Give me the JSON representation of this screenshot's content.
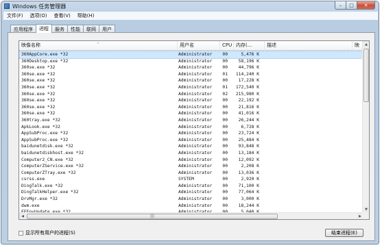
{
  "window": {
    "title": "Windows 任务管理器"
  },
  "caption_buttons": {
    "minimize": "–",
    "maximize": "□",
    "close": "✕"
  },
  "menu": [
    {
      "label": "文件(F)"
    },
    {
      "label": "选项(O)"
    },
    {
      "label": "查看(V)"
    },
    {
      "label": "帮助(H)"
    }
  ],
  "tabs": [
    {
      "label": "应用程序",
      "active": false
    },
    {
      "label": "进程",
      "active": true
    },
    {
      "label": "服务",
      "active": false
    },
    {
      "label": "性能",
      "active": false
    },
    {
      "label": "联网",
      "active": false
    },
    {
      "label": "用户",
      "active": false
    }
  ],
  "columns": {
    "name": "映像名称",
    "user": "用户名",
    "cpu": "CPU",
    "mem": "内存(...",
    "desc": "描述",
    "extra": "映"
  },
  "sort_indicator": "^",
  "processes": [
    {
      "name": "360AppCore.exe *32",
      "user": "Administrator",
      "cpu": "00",
      "mem": "5,476 K",
      "selected": true
    },
    {
      "name": "360Desktop.exe *32",
      "user": "Administrator",
      "cpu": "00",
      "mem": "58,196 K"
    },
    {
      "name": "360se.exe *32",
      "user": "Administrator",
      "cpu": "00",
      "mem": "44,796 K"
    },
    {
      "name": "360se.exe *32",
      "user": "Administrator",
      "cpu": "01",
      "mem": "114,240 K"
    },
    {
      "name": "360se.exe *32",
      "user": "Administrator",
      "cpu": "00",
      "mem": "17,228 K"
    },
    {
      "name": "360se.exe *32",
      "user": "Administrator",
      "cpu": "01",
      "mem": "172,540 K"
    },
    {
      "name": "360se.exe *32",
      "user": "Administrator",
      "cpu": "02",
      "mem": "215,980 K"
    },
    {
      "name": "360se.exe *32",
      "user": "Administrator",
      "cpu": "00",
      "mem": "22,192 K"
    },
    {
      "name": "360se.exe *32",
      "user": "Administrator",
      "cpu": "00",
      "mem": "21,816 K"
    },
    {
      "name": "360se.exe *32",
      "user": "Administrator",
      "cpu": "00",
      "mem": "41,016 K"
    },
    {
      "name": "360tray.exe *32",
      "user": "Administrator",
      "cpu": "00",
      "mem": "26,244 K"
    },
    {
      "name": "ApkLook.exe *32",
      "user": "Administrator",
      "cpu": "00",
      "mem": "6,728 K"
    },
    {
      "name": "AppSubProc.exe *32",
      "user": "Administrator",
      "cpu": "00",
      "mem": "23,724 K"
    },
    {
      "name": "AppSubProc.exe *32",
      "user": "Administrator",
      "cpu": "00",
      "mem": "25,484 K"
    },
    {
      "name": "baidunetdisk.exe *32",
      "user": "Administrator",
      "cpu": "00",
      "mem": "93,848 K"
    },
    {
      "name": "baidunetdiskhost.exe *32",
      "user": "Administrator",
      "cpu": "00",
      "mem": "13,184 K"
    },
    {
      "name": "Computer2_CN.exe *32",
      "user": "Administrator",
      "cpu": "00",
      "mem": "12,092 K"
    },
    {
      "name": "ComputerZService.exe *32",
      "user": "Administrator",
      "cpu": "00",
      "mem": "2,208 K"
    },
    {
      "name": "ComputerZTray.exe *32",
      "user": "Administrator",
      "cpu": "00",
      "mem": "13,036 K"
    },
    {
      "name": "csrss.exe",
      "user": "SYSTEM",
      "cpu": "00",
      "mem": "2,920 K"
    },
    {
      "name": "DingTalk.exe *32",
      "user": "Administrator",
      "cpu": "00",
      "mem": "71,100 K"
    },
    {
      "name": "DingTalkHelper.exe *32",
      "user": "Administrator",
      "cpu": "00",
      "mem": "77,064 K"
    },
    {
      "name": "DrvMgr.exe *32",
      "user": "Administrator",
      "cpu": "00",
      "mem": "3,000 K"
    },
    {
      "name": "dwm.exe",
      "user": "Administrator",
      "cpu": "00",
      "mem": "18,244 K"
    },
    {
      "name": "EFEnvUpdate.exe *32",
      "user": "Administrator",
      "cpu": "00",
      "mem": "5,040 K"
    },
    {
      "name": "explorer.exe",
      "user": "Administrator",
      "cpu": "00",
      "mem": "50,424 K"
    }
  ],
  "scrollbar": {
    "up": "▲",
    "down": "▼",
    "left": "◀",
    "right": "▶",
    "grip": "|||"
  },
  "show_all_label": "显示所有用户的进程(S)",
  "end_process_label": "结束进程(E)"
}
